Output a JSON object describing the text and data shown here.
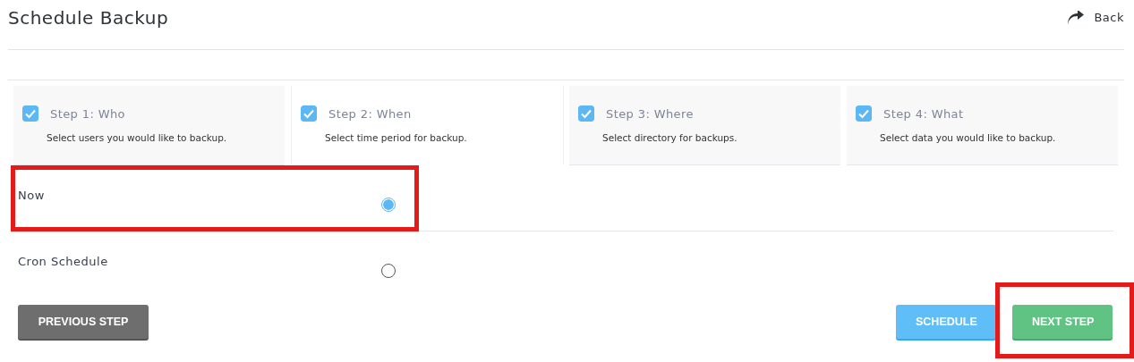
{
  "header": {
    "title": "Schedule Backup",
    "back_link": "Back"
  },
  "steps": [
    {
      "label": "Step 1: Who",
      "description": "Select users you would like to backup.",
      "checked": true,
      "selected": false
    },
    {
      "label": "Step 2: When",
      "description": "Select time period for backup.",
      "checked": true,
      "selected": true
    },
    {
      "label": "Step 3: Where",
      "description": "Select directory for backups.",
      "checked": true,
      "selected": false
    },
    {
      "label": "Step 4: What",
      "description": "Select data you would like to backup.",
      "checked": true,
      "selected": false
    }
  ],
  "options": [
    {
      "label": "Now",
      "selected": true,
      "highlighted": true
    },
    {
      "label": "Cron Schedule",
      "selected": false,
      "highlighted": false
    }
  ],
  "buttons": [
    {
      "label": "PREVIOUS STEP",
      "kind": "secondary",
      "highlighted": false
    },
    {
      "label": "SCHEDULE",
      "kind": "info",
      "highlighted": false
    },
    {
      "label": "NEXT STEP",
      "kind": "primary",
      "highlighted": true
    }
  ]
}
